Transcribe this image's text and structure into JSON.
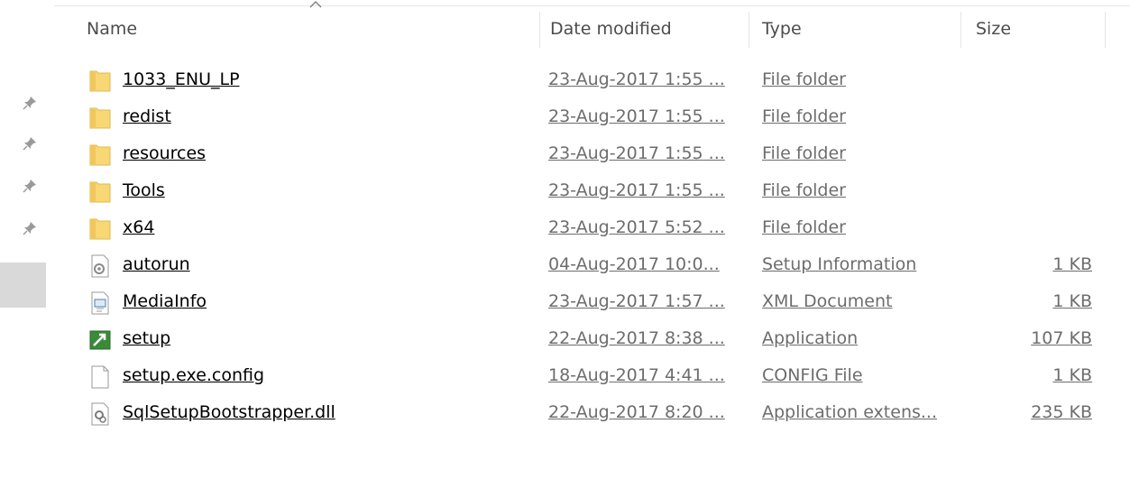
{
  "columns": {
    "name": "Name",
    "date": "Date modified",
    "type": "Type",
    "size": "Size"
  },
  "files": [
    {
      "name": "1033_ENU_LP",
      "date": "23-Aug-2017 1:55 ...",
      "type": "File folder",
      "size": "",
      "icon": "folder-icon"
    },
    {
      "name": "redist",
      "date": "23-Aug-2017 1:55 ...",
      "type": "File folder",
      "size": "",
      "icon": "folder-icon"
    },
    {
      "name": "resources",
      "date": "23-Aug-2017 1:55 ...",
      "type": "File folder",
      "size": "",
      "icon": "folder-icon"
    },
    {
      "name": "Tools",
      "date": "23-Aug-2017 1:55 ...",
      "type": "File folder",
      "size": "",
      "icon": "folder-icon"
    },
    {
      "name": "x64",
      "date": "23-Aug-2017 5:52 ...",
      "type": "File folder",
      "size": "",
      "icon": "folder-icon"
    },
    {
      "name": "autorun",
      "date": "04-Aug-2017 10:0...",
      "type": "Setup Information",
      "size": "1 KB",
      "icon": "setup-info-icon"
    },
    {
      "name": "MediaInfo",
      "date": "23-Aug-2017 1:57 ...",
      "type": "XML Document",
      "size": "1 KB",
      "icon": "xml-document-icon"
    },
    {
      "name": "setup",
      "date": "22-Aug-2017 8:38 ...",
      "type": "Application",
      "size": "107 KB",
      "icon": "application-icon"
    },
    {
      "name": "setup.exe.config",
      "date": "18-Aug-2017 4:41 ...",
      "type": "CONFIG File",
      "size": "1 KB",
      "icon": "blank-file-icon"
    },
    {
      "name": "SqlSetupBootstrapper.dll",
      "date": "22-Aug-2017 8:20 ...",
      "type": "Application extens...",
      "size": "235 KB",
      "icon": "dll-file-icon"
    }
  ]
}
